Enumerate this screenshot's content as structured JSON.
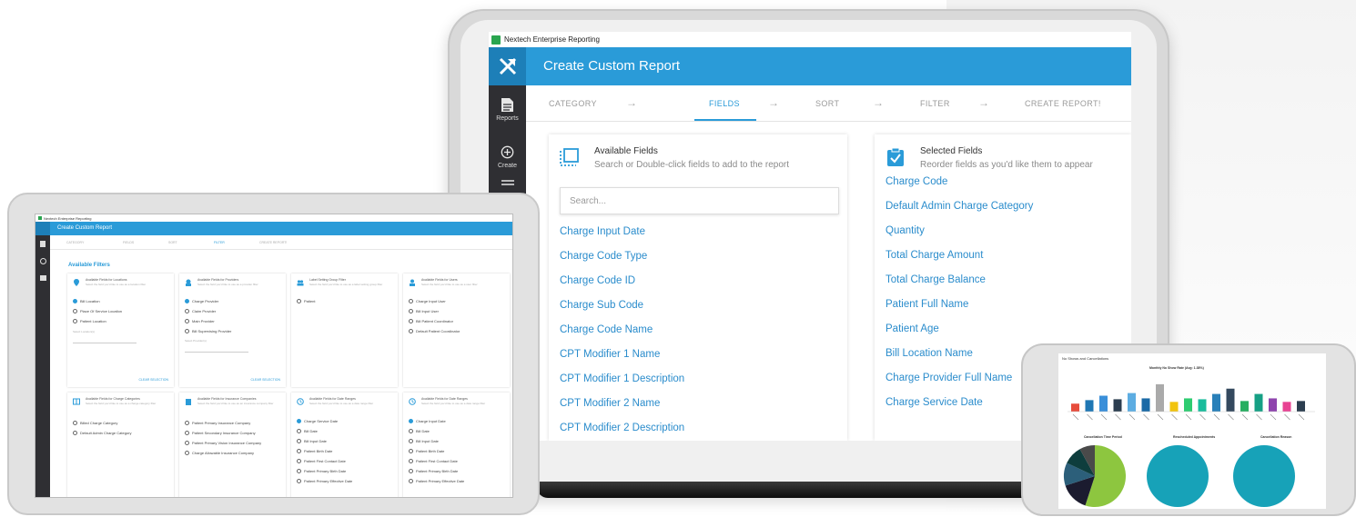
{
  "laptop": {
    "window_title": "Nextech Enterprise Reporting",
    "app_title": "Create Custom Report",
    "sidebar": [
      {
        "label": "Reports",
        "icon": "document-icon"
      },
      {
        "label": "Create",
        "icon": "plus-circle-icon"
      }
    ],
    "steps": [
      "CATEGORY",
      "FIELDS",
      "SORT",
      "FILTER",
      "CREATE REPORT!"
    ],
    "active_step": "FIELDS",
    "available": {
      "title": "Available Fields",
      "subtitle": "Search or Double-click fields to add to the report",
      "search_placeholder": "Search...",
      "fields": [
        "Charge Input Date",
        "Charge Code Type",
        "Charge Code ID",
        "Charge Sub Code",
        "Charge Code Name",
        "CPT Modifier 1 Name",
        "CPT Modifier 1 Description",
        "CPT Modifier 2 Name",
        "CPT Modifier 2 Description"
      ]
    },
    "selected": {
      "title": "Selected Fields",
      "subtitle": "Reorder fields as you'd like them to appear",
      "fields": [
        "Charge Code",
        "Default Admin Charge Category",
        "Quantity",
        "Total Charge Amount",
        "Total Charge Balance",
        "Patient Full Name",
        "Patient Age",
        "Bill Location Name",
        "Charge Provider Full Name",
        "Charge Service Date"
      ]
    },
    "colors": {
      "accent": "#2a9bd8",
      "sidebar": "#2f2f33"
    }
  },
  "tablet": {
    "window_title": "Nextech Enterprise Reporting",
    "app_title": "Create Custom Report",
    "steps": [
      "CATEGORY",
      "FIELDS",
      "SORT",
      "FILTER",
      "CREATE REPORT!"
    ],
    "heading": "Available Filters",
    "cards": [
      {
        "title": "Available Fields for Locations",
        "sub": "Select the field you'd like to use as a location filter",
        "options": [
          "Bill Location",
          "Place Of Service Location",
          "Patient Location"
        ],
        "selected": 0,
        "extra": "Select Location(s)",
        "clear": "CLEAR SELECTION"
      },
      {
        "title": "Available Fields for Providers",
        "sub": "Select the field you'd like to use as a provider filter",
        "options": [
          "Charge Provider",
          "Claim Provider",
          "Main Provider",
          "Bill Supervising Provider"
        ],
        "selected": 0,
        "extra": "Select Provider(s)",
        "clear": "CLEAR SELECTION"
      },
      {
        "title": "Label Setting Group Filter",
        "sub": "Select the field you'd like to use as a label setting group filter",
        "options": [
          "Patient"
        ],
        "selected": -1
      },
      {
        "title": "Available Fields for Users",
        "sub": "Select the field you'd like to use as a user filter",
        "options": [
          "Charge Input User",
          "Bill Input User",
          "Bill Patient Coordinator",
          "Default Patient Coordinator"
        ],
        "selected": -1
      },
      {
        "title": "Available Fields for Charge Categories",
        "sub": "Select the field you'd like to use as a charge category filter",
        "options": [
          "Billed Charge Category",
          "Default Admin Charge Category"
        ],
        "selected": -1
      },
      {
        "title": "Available Fields for Insurance Companies",
        "sub": "Select the field you'd like to use as an insurance company filter",
        "options": [
          "Patient Primary Insurance Company",
          "Patient Secondary Insurance Company",
          "Patient Primary Vision Insurance Company",
          "Charge Allowable Insurance Company"
        ],
        "selected": -1
      },
      {
        "title": "Available Fields for Date Ranges",
        "sub": "Select the field you'd like to use as a date range filter",
        "options": [
          "Charge Service Date",
          "Bill Date",
          "Bill Input Date",
          "Patient Birth Date",
          "Patient First Contact Date",
          "Patient Primary Birth Date",
          "Patient Primary Effective Date"
        ],
        "selected": 0
      },
      {
        "title": "Available Fields for Date Ranges",
        "sub": "Select the field you'd like to use as a date range filter",
        "options": [
          "Charge Input Date",
          "Bill Date",
          "Bill Input Date",
          "Patient Birth Date",
          "Patient First Contact Date",
          "Patient Primary Birth Date",
          "Patient Primary Effective Date"
        ],
        "selected": 0
      }
    ]
  },
  "phone": {
    "report_title": "No Shows and Cancellations",
    "chart_title": "Monthly No Show Rate (Avg: 1.38%)",
    "section_titles": [
      "Cancellation Time Period",
      "Rescheduled Appointments",
      "Cancellation Reason"
    ],
    "chart_data": {
      "type": "bar",
      "title": "Monthly No Show Rate (Avg: 1.38%)",
      "values": [
        0.9,
        1.3,
        1.8,
        1.4,
        2.1,
        1.5,
        3.1,
        1.1,
        1.5,
        1.4,
        2.0,
        2.6,
        1.2,
        2.0,
        1.5,
        1.1,
        1.2
      ],
      "colors": [
        "#e74c3c",
        "#1f77b4",
        "#3a8fd9",
        "#2c3e50",
        "#5dade2",
        "#1a6aa6",
        "#aaaaaa",
        "#f1c40f",
        "#2ecc71",
        "#1abc9c",
        "#2980b9",
        "#34495e",
        "#27ae60",
        "#16a085",
        "#8e44ad",
        "#e84393",
        "#2c3e50"
      ]
    },
    "pies": [
      {
        "slices": [
          0.55,
          0.15,
          0.12,
          0.1,
          0.08
        ],
        "colors": [
          "#8dc63f",
          "#1b1b2f",
          "#2c5f7a",
          "#0e3d3d",
          "#4a4a4a"
        ]
      },
      {
        "slices": [
          1.0
        ],
        "colors": [
          "#17a2b8"
        ]
      },
      {
        "slices": [
          1.0
        ],
        "colors": [
          "#17a2b8"
        ]
      }
    ]
  }
}
